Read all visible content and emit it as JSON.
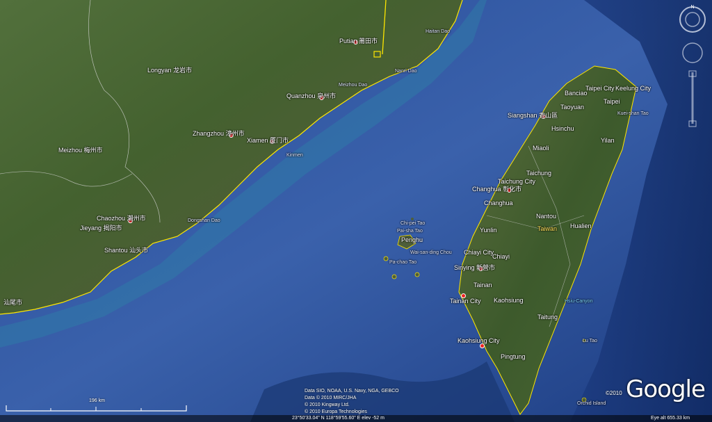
{
  "map": {
    "places": [
      {
        "id": "putian",
        "text": "Putian",
        "sub": "莆田市"
      },
      {
        "id": "longyan",
        "text": "Longyan",
        "sub": "龙岩市"
      },
      {
        "id": "quanzhou",
        "text": "Quanzhou",
        "sub": "泉州市"
      },
      {
        "id": "zhangzhou",
        "text": "Zhangzhou",
        "sub": "漳州市"
      },
      {
        "id": "xiamen",
        "text": "Xiamen",
        "sub": "厦门市"
      },
      {
        "id": "meizhou",
        "text": "Meizhou",
        "sub": "梅州市"
      },
      {
        "id": "chaozhou",
        "text": "Chaozhou",
        "sub": "潮州市"
      },
      {
        "id": "jieyang",
        "text": "Jieyang",
        "sub": "揭阳市"
      },
      {
        "id": "shantou",
        "text": "Shantou",
        "sub": "汕头市"
      },
      {
        "id": "shanwei",
        "text": "",
        "sub": "汕尾市"
      }
    ],
    "islands": [
      {
        "id": "haitan",
        "text": "Haitan Dao"
      },
      {
        "id": "nanri",
        "text": "Nanri Dao"
      },
      {
        "id": "meizhou-dao",
        "text": "Meizhou Dao"
      },
      {
        "id": "kinmen",
        "text": "Kinmen"
      },
      {
        "id": "dongshan",
        "text": "Dongshan Dao"
      },
      {
        "id": "penghu",
        "text": "Penghu"
      },
      {
        "id": "chipei",
        "text": "Chi-pei Tao"
      },
      {
        "id": "paishatao",
        "text": "Pai-sha Tao"
      },
      {
        "id": "waisanding",
        "text": "Wai-san-ding Chou"
      },
      {
        "id": "pachao",
        "text": "Pa-chao Tao"
      },
      {
        "id": "kueishan",
        "text": "Kuei-shan Tao"
      },
      {
        "id": "lutao",
        "text": "Lu Tao"
      },
      {
        "id": "orchid",
        "text": "Orchid Island"
      },
      {
        "id": "hsincanyon",
        "text": "Hsiu-Canyon"
      }
    ],
    "taiwan": [
      {
        "id": "taipei-city",
        "text": "Taipei City"
      },
      {
        "id": "keelung",
        "text": "Keelung City"
      },
      {
        "id": "banciao",
        "text": "Banciao"
      },
      {
        "id": "taipei",
        "text": "Taipei"
      },
      {
        "id": "taoyuan",
        "text": "Taoyuan"
      },
      {
        "id": "siangshan",
        "text": "Siangshan",
        "sub": "香山區"
      },
      {
        "id": "hsinchu",
        "text": "Hsinchu"
      },
      {
        "id": "yilan",
        "text": "Yilan"
      },
      {
        "id": "miaoli",
        "text": "Miaoli"
      },
      {
        "id": "taichung",
        "text": "Taichung"
      },
      {
        "id": "taichung-city",
        "text": "Taichung City"
      },
      {
        "id": "changhua",
        "text": "Changhua",
        "sub": "彰化市"
      },
      {
        "id": "changhua2",
        "text": "Changhua"
      },
      {
        "id": "nantou",
        "text": "Nantou"
      },
      {
        "id": "yunlin",
        "text": "Yunlin"
      },
      {
        "id": "taiwan",
        "text": "Taiwan"
      },
      {
        "id": "hualien",
        "text": "Hualien"
      },
      {
        "id": "chiayi-city",
        "text": "Chiayi City"
      },
      {
        "id": "chiayi",
        "text": "Chiayi"
      },
      {
        "id": "sinying",
        "text": "Sinying",
        "sub": "新營市"
      },
      {
        "id": "tainan",
        "text": "Tainan"
      },
      {
        "id": "tainan-city",
        "text": "Tainan City"
      },
      {
        "id": "kaohsiung",
        "text": "Kaohsiung"
      },
      {
        "id": "taitung",
        "text": "Taitung"
      },
      {
        "id": "kaohsiung-city",
        "text": "Kaohsiung City"
      },
      {
        "id": "pingtung",
        "text": "Pingtung"
      }
    ]
  },
  "credits": {
    "line1": "Data SIO, NOAA, U.S. Navy, NGA, GEBCO",
    "line2": "Data © 2010 MIRC/JHA",
    "line3": "© 2010 Kingway Ltd.",
    "line4": "© 2010 Europa Technologies"
  },
  "logo": {
    "text": "Google",
    "copyright": "©2010"
  },
  "scale": {
    "label": "196 km"
  },
  "status": {
    "coords": "23°50'33.04\" N     118°59'55.60\" E   elev  -52 m",
    "eye": "Eye alt   655.33 km"
  },
  "nav": {
    "north_label": "N"
  },
  "colors": {
    "ocean": "#2f55a0",
    "land": "#3e5a2c",
    "border": "#ffe600"
  }
}
